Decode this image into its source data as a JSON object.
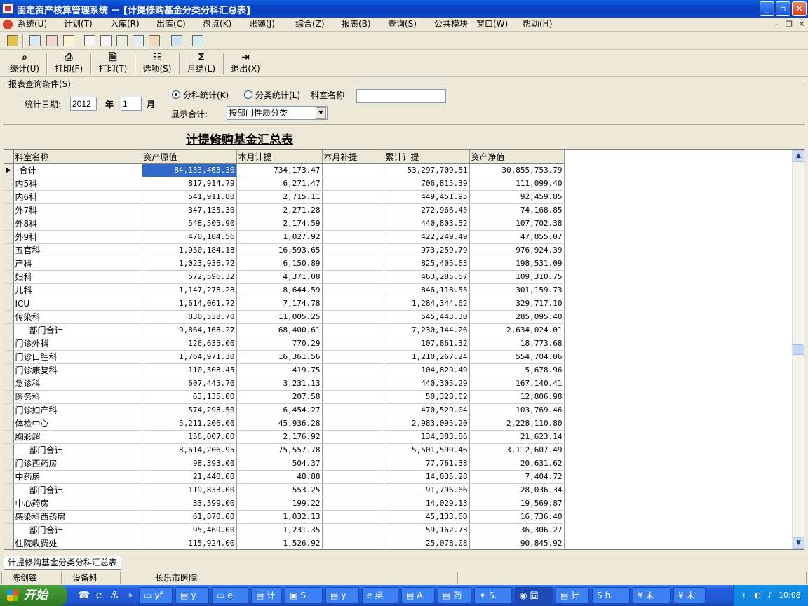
{
  "window": {
    "title": "固定资产核算管理系统 － [计提修购基金分类分科汇总表]",
    "min_label": "_",
    "max_label": "▫",
    "close_label": "✕"
  },
  "menu": [
    "系统(U)",
    "计划(T)",
    "入库(R)",
    "出库(C)",
    "盘点(K)",
    "账簿(J)",
    "综合(Z)",
    "报表(B)",
    "查询(S)",
    "公共模块",
    "窗口(W)",
    "帮助(H)"
  ],
  "toolbar2": [
    {
      "label": "统计(U)",
      "icon": "binoculars-icon",
      "glyph": "⌕"
    },
    {
      "label": "打印(F)",
      "icon": "printer-icon",
      "glyph": "⎙"
    },
    {
      "label": "打印(T)",
      "icon": "print-preview-icon",
      "glyph": "🗎"
    },
    {
      "label": "选项(S)",
      "icon": "options-icon",
      "glyph": "☷"
    },
    {
      "label": "月结(L)",
      "icon": "sigma-icon",
      "glyph": "Σ"
    },
    {
      "label": "退出(X)",
      "icon": "exit-door-icon",
      "glyph": "⇥"
    }
  ],
  "query": {
    "legend": "报表查询条件(S)",
    "date_label": "统计日期:",
    "year_value": "2012",
    "year_unit": "年",
    "month_value": "1",
    "month_unit": "月",
    "radio1": "分科统计(K)",
    "radio2": "分类统计(L)",
    "dept_label": "科室名称",
    "dept_value": "",
    "sum_label": "显示合计:",
    "sum_value": "按部门性质分类"
  },
  "report_title": "计提修购基金汇总表",
  "table": {
    "columns": [
      "科室名称",
      "资产原值",
      "本月计提",
      "本月补提",
      "累计计提",
      "资产净值"
    ],
    "rows": [
      [
        "合计",
        "84,153,463.30",
        "734,173.47",
        "",
        "53,297,709.51",
        "30,855,753.79"
      ],
      [
        "内5科",
        "817,914.79",
        "6,271.47",
        "",
        "706,815.39",
        "111,099.40"
      ],
      [
        "内6科",
        "541,911.80",
        "2,715.11",
        "",
        "449,451.95",
        "92,459.85"
      ],
      [
        "外7科",
        "347,135.30",
        "2,271.28",
        "",
        "272,966.45",
        "74,168.85"
      ],
      [
        "外8科",
        "548,505.90",
        "2,174.59",
        "",
        "440,803.52",
        "107,702.38"
      ],
      [
        "外9科",
        "470,104.56",
        "1,027.92",
        "",
        "422,249.49",
        "47,855.07"
      ],
      [
        "五官科",
        "1,950,184.18",
        "16,593.65",
        "",
        "973,259.79",
        "976,924.39"
      ],
      [
        "产科",
        "1,023,936.72",
        "6,150.89",
        "",
        "825,405.63",
        "198,531.09"
      ],
      [
        "妇科",
        "572,596.32",
        "4,371.08",
        "",
        "463,285.57",
        "109,310.75"
      ],
      [
        "儿科",
        "1,147,278.28",
        "8,644.59",
        "",
        "846,118.55",
        "301,159.73"
      ],
      [
        "ICU",
        "1,614,061.72",
        "7,174.78",
        "",
        "1,284,344.62",
        "329,717.10"
      ],
      [
        "传染科",
        "830,538.70",
        "11,005.25",
        "",
        "545,443.30",
        "285,095.40"
      ],
      [
        "部门合计",
        "9,864,168.27",
        "68,400.61",
        "",
        "7,230,144.26",
        "2,634,024.01"
      ],
      [
        "门诊外科",
        "126,635.00",
        "770.29",
        "",
        "107,861.32",
        "18,773.68"
      ],
      [
        "门诊口腔科",
        "1,764,971.30",
        "16,361.56",
        "",
        "1,210,267.24",
        "554,704.06"
      ],
      [
        "门诊康复科",
        "110,508.45",
        "419.75",
        "",
        "104,829.49",
        "5,678.96"
      ],
      [
        "急诊科",
        "607,445.70",
        "3,231.13",
        "",
        "440,305.29",
        "167,140.41"
      ],
      [
        "医务科",
        "63,135.00",
        "207.58",
        "",
        "50,328.02",
        "12,806.98"
      ],
      [
        "门诊妇产科",
        "574,298.50",
        "6,454.27",
        "",
        "470,529.04",
        "103,769.46"
      ],
      [
        "体检中心",
        "5,211,206.00",
        "45,936.28",
        "",
        "2,983,095.20",
        "2,228,110.80"
      ],
      [
        "胸彩超",
        "156,007.00",
        "2,176.92",
        "",
        "134,383.86",
        "21,623.14"
      ],
      [
        "部门合计",
        "8,614,206.95",
        "75,557.78",
        "",
        "5,501,599.46",
        "3,112,607.49"
      ],
      [
        "门诊西药房",
        "98,393.00",
        "504.37",
        "",
        "77,761.38",
        "20,631.62"
      ],
      [
        "中药房",
        "21,440.00",
        "48.88",
        "",
        "14,035.28",
        "7,404.72"
      ],
      [
        "部门合计",
        "119,833.00",
        "553.25",
        "",
        "91,796.66",
        "28,036.34"
      ],
      [
        "中心药房",
        "33,599.00",
        "199.22",
        "",
        "14,029.13",
        "19,569.87"
      ],
      [
        "感染科西药房",
        "61,870.00",
        "1,032.13",
        "",
        "45,133.60",
        "16,736.40"
      ],
      [
        "部门合计",
        "95,469.00",
        "1,231.35",
        "",
        "59,162.73",
        "36,306.27"
      ],
      [
        "住院收费处",
        "115,924.00",
        "1,526.92",
        "",
        "25,078.08",
        "90,845.92"
      ]
    ]
  },
  "tab": "计提修购基金分类分科汇总表",
  "status": [
    "陈剑锋",
    "设备科",
    "长乐市医院"
  ],
  "taskbar": {
    "start": "开始",
    "tasks": [
      {
        "label": "yf",
        "icon": "folder-icon",
        "glyph": "▭"
      },
      {
        "label": "y.",
        "icon": "document-icon",
        "glyph": "▤"
      },
      {
        "label": "e.",
        "icon": "folder-icon",
        "glyph": "▭"
      },
      {
        "label": "计",
        "icon": "app-icon",
        "glyph": "▤"
      },
      {
        "label": "S.",
        "icon": "window-icon",
        "glyph": "▣"
      },
      {
        "label": "y.",
        "icon": "document-icon",
        "glyph": "▤"
      },
      {
        "label": "桌",
        "icon": "ie-icon",
        "glyph": "e"
      },
      {
        "label": "A.",
        "icon": "document-icon",
        "glyph": "▤"
      },
      {
        "label": "药",
        "icon": "app-icon",
        "glyph": "▤"
      },
      {
        "label": "S.",
        "icon": "app-icon",
        "glyph": "✦"
      },
      {
        "label": "固",
        "icon": "asset-app-icon",
        "glyph": "◉"
      },
      {
        "label": "计",
        "icon": "app-icon",
        "glyph": "▤"
      },
      {
        "label": "h.",
        "icon": "app-icon",
        "glyph": "S"
      },
      {
        "label": "未",
        "icon": "app-icon",
        "glyph": "¥"
      },
      {
        "label": "未",
        "icon": "app-icon",
        "glyph": "¥"
      }
    ],
    "clock": "10:08"
  }
}
